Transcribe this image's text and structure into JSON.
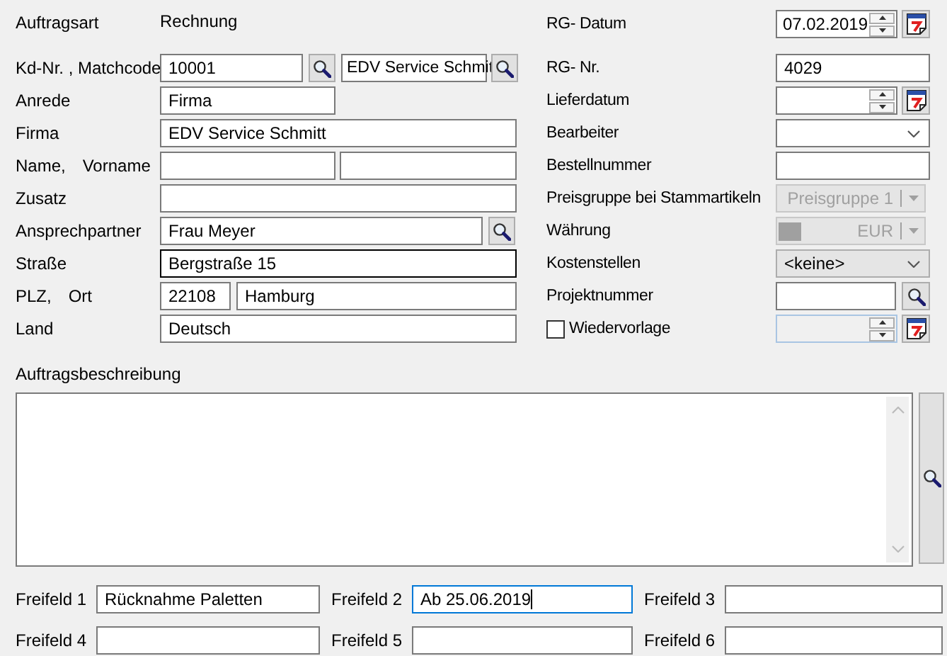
{
  "order_type": {
    "label": "Auftragsart",
    "value": "Rechnung"
  },
  "customer": [
    {
      "kind": "search-pair",
      "labels": [
        "Kd-Nr. , Matchcode"
      ],
      "fields": [
        {
          "value": "10001",
          "hovered": false
        },
        {
          "value": "EDV Service Schmit",
          "hovered": false
        }
      ]
    },
    {
      "kind": "short",
      "labels": [
        "Anrede"
      ],
      "fields": [
        {
          "value": "Firma",
          "hovered": false
        }
      ]
    },
    {
      "kind": "full",
      "labels": [
        "Firma"
      ],
      "fields": [
        {
          "value": "EDV Service Schmitt",
          "hovered": false
        }
      ]
    },
    {
      "kind": "pair",
      "labels": [
        "Name,",
        "Vorname"
      ],
      "fields": [
        {
          "hovered": false
        },
        {
          "hovered": false
        }
      ]
    },
    {
      "kind": "full",
      "labels": [
        "Zusatz"
      ],
      "fields": [
        {
          "hovered": false
        }
      ]
    },
    {
      "kind": "search",
      "labels": [
        "Ansprechpartner"
      ],
      "fields": [
        {
          "value": "Frau Meyer",
          "hovered": false
        }
      ]
    },
    {
      "kind": "full",
      "labels": [
        "Straße"
      ],
      "fields": [
        {
          "value": "Bergstraße 15",
          "hovered": true
        }
      ]
    },
    {
      "kind": "zip-city",
      "labels": [
        "PLZ,",
        "Ort"
      ],
      "fields": [
        {
          "value": "22108",
          "hovered": false
        },
        {
          "value": "Hamburg",
          "hovered": false
        }
      ]
    },
    {
      "kind": "full",
      "labels": [
        "Land"
      ],
      "fields": [
        {
          "value": "Deutsch",
          "hovered": false
        }
      ]
    }
  ],
  "invoice": [
    {
      "kind": "date",
      "label": "RG- Datum",
      "value": "07.02.2019",
      "disabled": false
    },
    {
      "kind": "text",
      "label": "RG- Nr.",
      "value": "4029"
    },
    {
      "kind": "date",
      "label": "Lieferdatum",
      "disabled": false
    },
    {
      "kind": "dropdown",
      "label": "Bearbeiter",
      "editable": true,
      "disabled": false
    },
    {
      "kind": "text",
      "label": "Bestellnummer"
    },
    {
      "kind": "dropdown",
      "label": "Preisgruppe bei Stammartikeln",
      "value": "Preisgruppe 1",
      "editable": false,
      "disabled": true
    },
    {
      "kind": "currency",
      "label": "Währung",
      "value": "EUR",
      "disabled": true
    },
    {
      "kind": "dropdown",
      "label": "Kostenstellen",
      "value": "<keine>",
      "editable": false,
      "disabled": false
    },
    {
      "kind": "search",
      "label": "Projektnummer"
    },
    {
      "kind": "checkbox-date",
      "label": "Wiedervorlage",
      "checked": false,
      "disabled": true
    }
  ],
  "description": {
    "label": "Auftragsbeschreibung"
  },
  "free_fields": [
    {
      "label": "Freifeld 1",
      "value": "Rücknahme Paletten",
      "focused": false
    },
    {
      "label": "Freifeld 2",
      "value": "Ab 25.06.2019",
      "focused": true
    },
    {
      "label": "Freifeld 3",
      "focused": false
    },
    {
      "label": "Freifeld 4",
      "focused": false
    },
    {
      "label": "Freifeld 5",
      "focused": false
    },
    {
      "label": "Freifeld 6",
      "focused": false
    }
  ]
}
